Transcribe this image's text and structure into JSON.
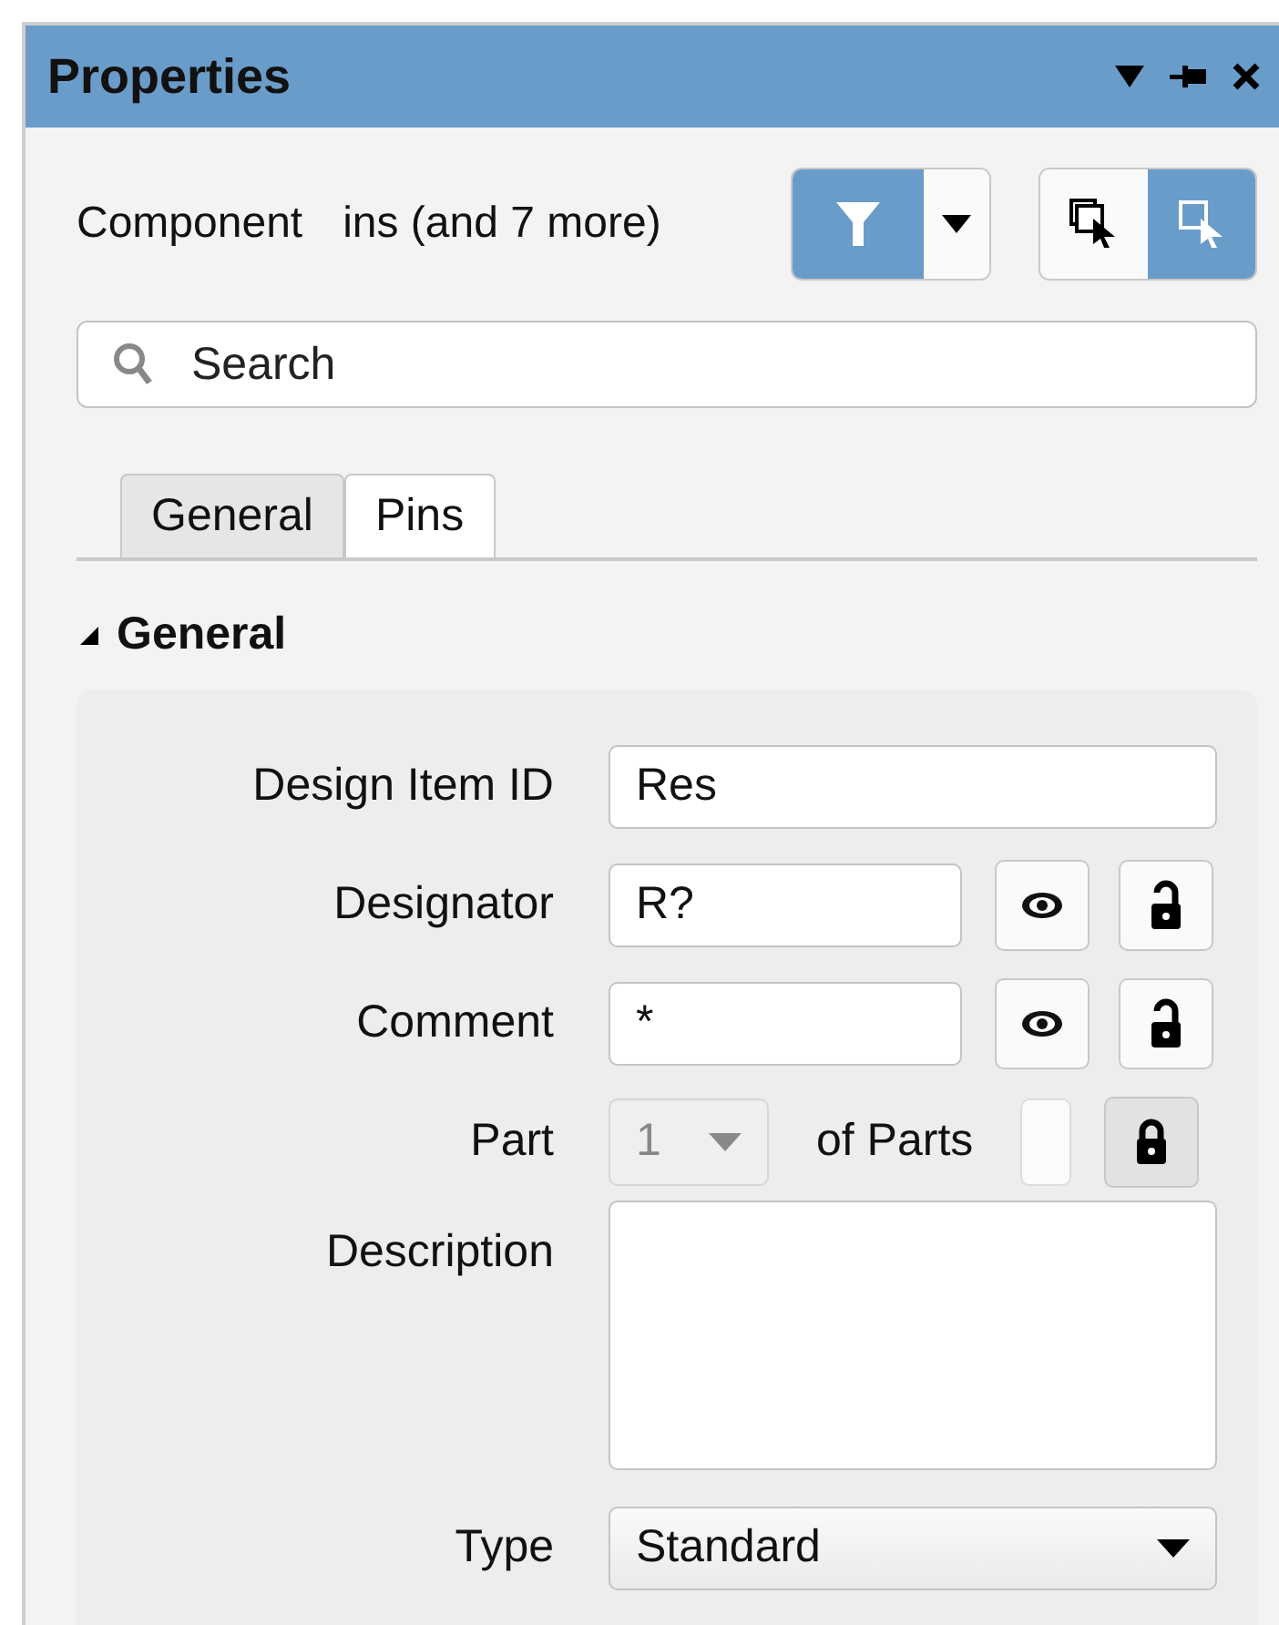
{
  "window": {
    "title": "Properties"
  },
  "filter": {
    "label": "Component",
    "label_tail": "ins (and 7 more)",
    "filter_on": true
  },
  "select_modes": [
    {
      "selected": false
    },
    {
      "selected": true
    }
  ],
  "search": {
    "placeholder": "Search"
  },
  "tabs": [
    {
      "label": "General",
      "selected": false
    },
    {
      "label": "Pins",
      "selected": true
    }
  ],
  "section": {
    "title": "General",
    "expanded": true
  },
  "rows": [
    {
      "kind": "text",
      "label": "Design Item ID",
      "value": "Res"
    },
    {
      "kind": "toggles",
      "label": "Designator",
      "value": "R?",
      "visible": true,
      "locked": false
    },
    {
      "kind": "toggles",
      "label": "Comment",
      "value": "*",
      "visible": true,
      "locked": false
    },
    {
      "kind": "part",
      "label": "Part",
      "value": "1",
      "suffix": "of Parts",
      "locked": true
    },
    {
      "kind": "textarea",
      "label": "Description"
    },
    {
      "kind": "dropdown",
      "label": "Type",
      "value": "Standard"
    }
  ]
}
